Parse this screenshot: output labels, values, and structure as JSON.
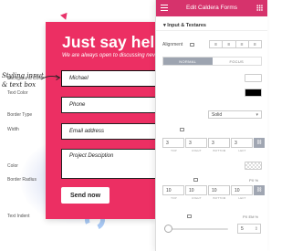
{
  "form": {
    "headline": "Just say hell",
    "subline": "We are always open to discussing nev",
    "fields": {
      "name": "Michael",
      "phone": "Phone",
      "email": "Email address",
      "description": "Project Desciption"
    },
    "send_label": "Send now"
  },
  "annotation": {
    "line1": "Styling input",
    "line2": "& text box"
  },
  "panel": {
    "title": "Edit Caldera Forms",
    "section": "Input & Textares",
    "alignment_label": "Alignment",
    "align_icons": [
      "align-left-icon",
      "align-center-icon",
      "align-right-icon",
      "align-justify-icon"
    ],
    "tabs": [
      "NORMAL",
      "FOCUS"
    ],
    "background_color_label": "Background Color",
    "text_color_label": "Text Color",
    "border_type_label": "Border Type",
    "border_type_value": "Solid",
    "width_label": "Width",
    "width_values": [
      "3",
      "3",
      "3",
      "3"
    ],
    "dim_labels": [
      "TOP",
      "RIGHT",
      "BOTTOM",
      "LEFT"
    ],
    "color_label": "Color",
    "border_radius_label": "Border Radius",
    "radius_values": [
      "10",
      "10",
      "10",
      "10"
    ],
    "radius_unit": "PX %",
    "text_indent_label": "Text Indent",
    "text_indent_unit": "PX EM %",
    "text_indent_value": "5"
  },
  "colors": {
    "form_bg": "#ec2f63",
    "panel_header": "#d6336c",
    "active_tab": "#9da4b0",
    "background_color_swatch": "#ffffff",
    "text_color_swatch": "#000000"
  }
}
